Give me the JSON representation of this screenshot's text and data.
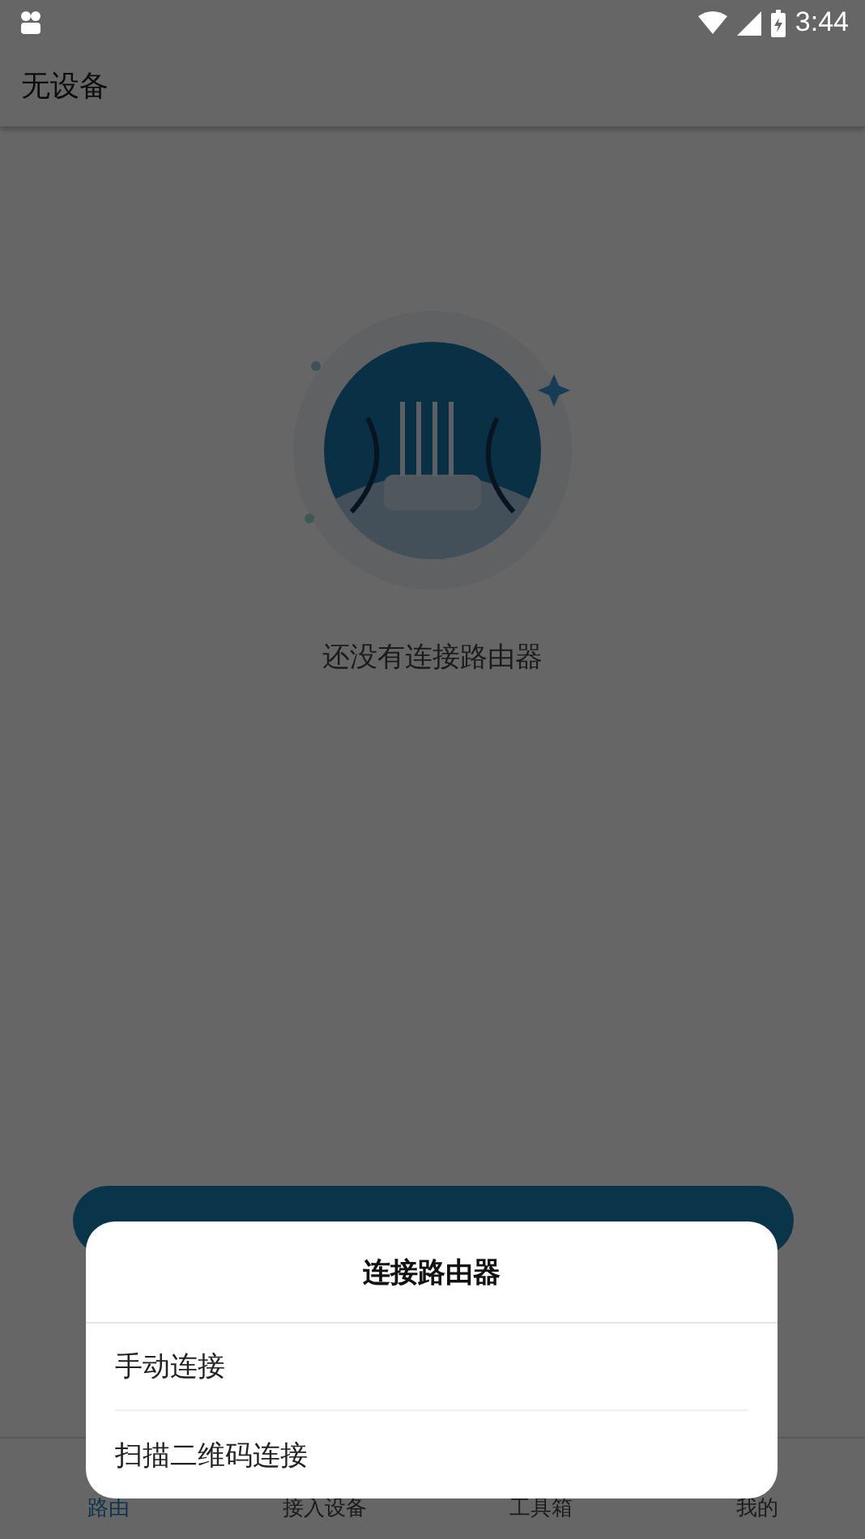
{
  "status_bar": {
    "time": "3:44"
  },
  "app_bar": {
    "title": "无设备"
  },
  "empty_state": {
    "message": "还没有连接路由器"
  },
  "bottom_nav": [
    {
      "label": "路由",
      "selected": true
    },
    {
      "label": "接入设备",
      "selected": false
    },
    {
      "label": "工具箱",
      "selected": false
    },
    {
      "label": "我的",
      "selected": false
    }
  ],
  "dialog": {
    "title": "连接路由器",
    "options": [
      "手动连接",
      "扫描二维码连接"
    ]
  }
}
